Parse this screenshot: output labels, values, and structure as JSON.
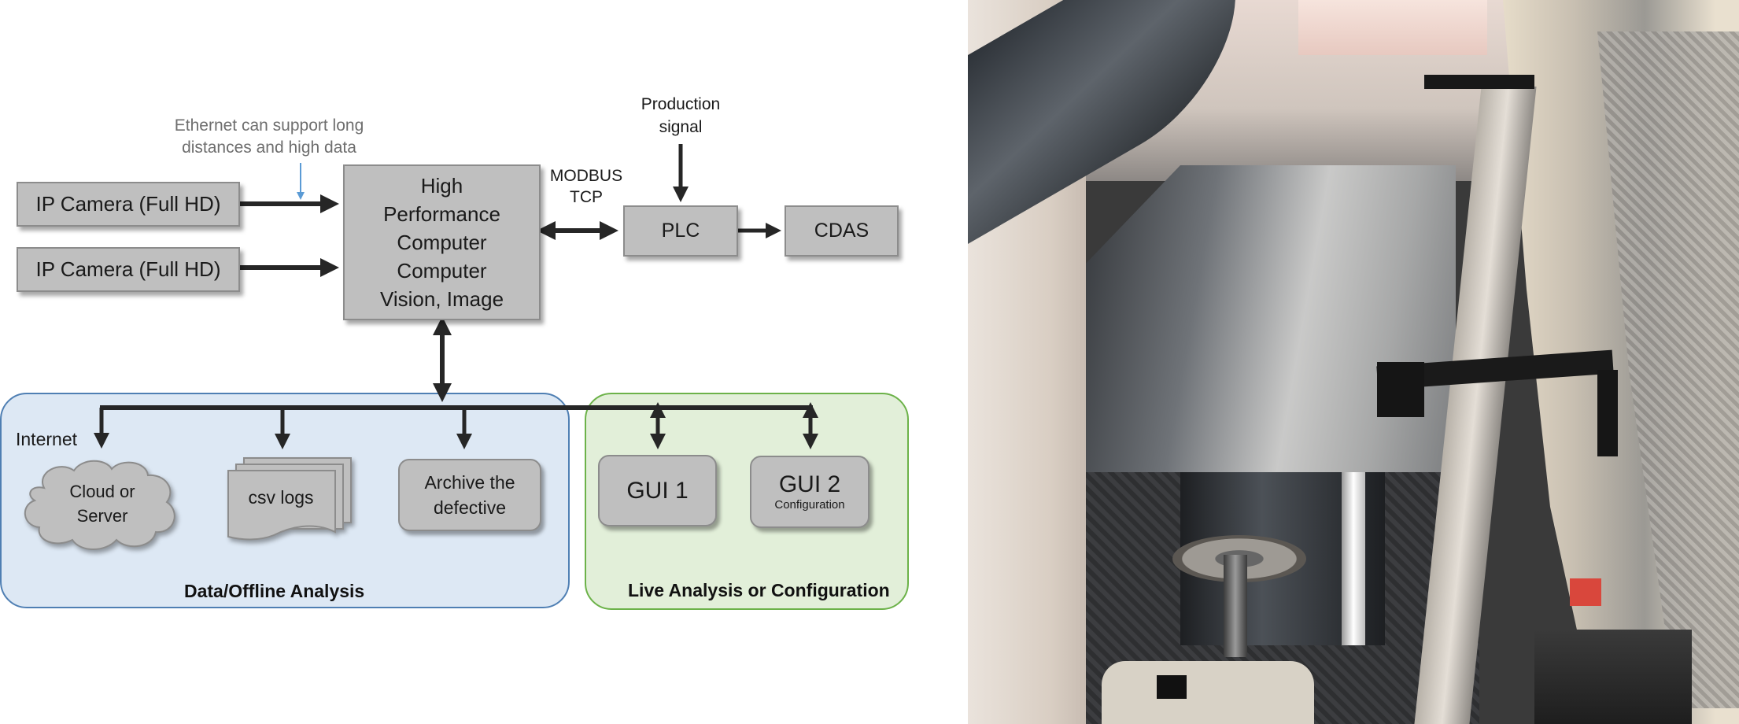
{
  "diagram": {
    "annotation": {
      "line1": "Ethernet can support long",
      "line2": "distances and high data"
    },
    "cameras": [
      {
        "label": "IP Camera (Full HD)"
      },
      {
        "label": "IP Camera (Full HD)"
      }
    ],
    "main_computer": {
      "lines": [
        "High",
        "Performance",
        "Computer",
        "Computer",
        "Vision, Image"
      ]
    },
    "link_label": {
      "line1": "MODBUS",
      "line2": "TCP"
    },
    "production_signal": {
      "line1": "Production",
      "line2": "signal"
    },
    "plc": {
      "label": "PLC"
    },
    "cdas": {
      "label": "CDAS"
    },
    "offline_panel": {
      "title": "Data/Offline Analysis",
      "internet_label": "Internet",
      "cloud": {
        "line1": "Cloud or",
        "line2": "Server"
      },
      "csv": {
        "label": "csv logs"
      },
      "archive": {
        "line1": "Archive the",
        "line2": "defective"
      }
    },
    "live_panel": {
      "title": "Live Analysis or Configuration",
      "gui1": {
        "label": "GUI 1"
      },
      "gui2": {
        "label": "GUI 2",
        "sublabel": "Configuration"
      }
    },
    "colors": {
      "box_fill": "#bfbfbf",
      "box_border": "#8c8c8c",
      "arrow": "#262626",
      "annotation_arrow": "#5b9bd5",
      "offline_fill": "#dde8f4",
      "offline_border": "#4f7fb3",
      "live_fill": "#e2efd9",
      "live_border": "#6cb249",
      "annotation_text": "#6e6e6e"
    }
  },
  "photo": {
    "subject": "industrial sheet roll inspection line with mounted camera"
  }
}
